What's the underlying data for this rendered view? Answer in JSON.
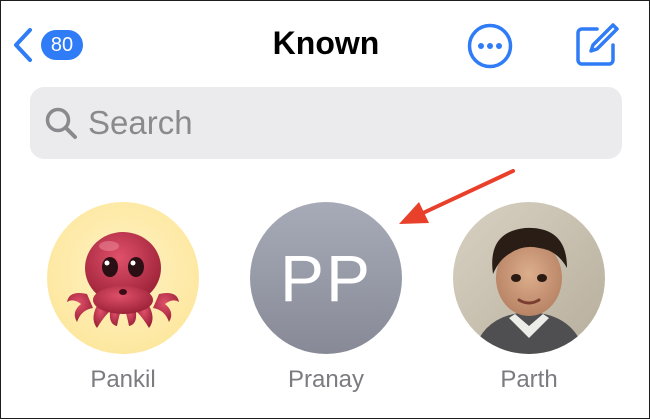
{
  "nav": {
    "back_badge": "80",
    "title": "Known"
  },
  "search": {
    "placeholder": "Search"
  },
  "contacts": [
    {
      "name": "Pankil",
      "avatar": "octopus-memoji"
    },
    {
      "name": "Pranay",
      "initials": "PP",
      "avatar": "initials"
    },
    {
      "name": "Parth",
      "avatar": "photo"
    }
  ],
  "colors": {
    "accent": "#2f7cf6",
    "annotation_arrow": "#e8402a",
    "search_bg": "#ebebed"
  }
}
